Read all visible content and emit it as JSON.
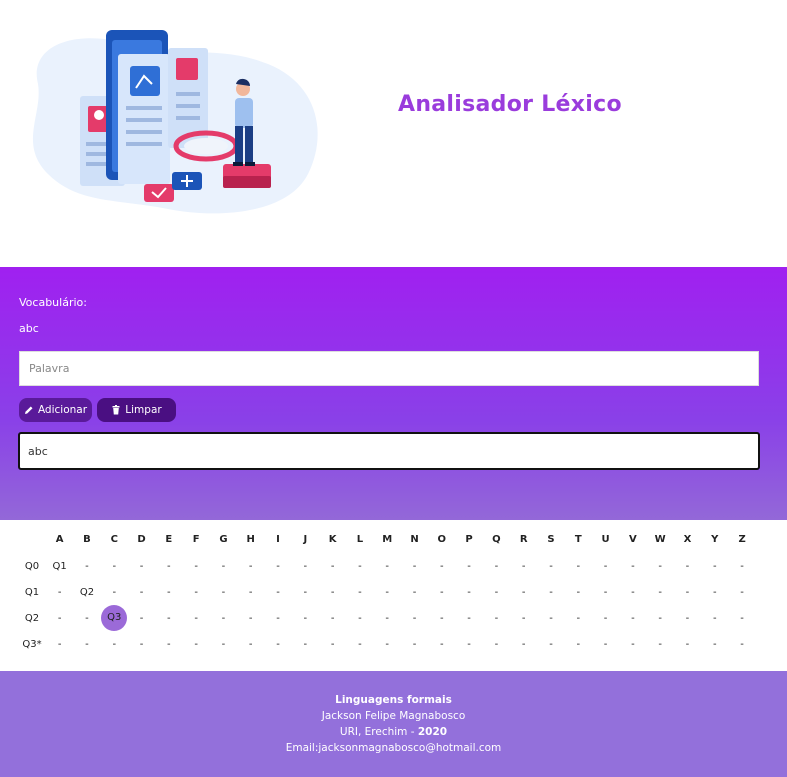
{
  "header": {
    "title": "Analisador Léxico"
  },
  "vocabulary": {
    "label": "Vocabulário:",
    "words": "abc",
    "word_input_placeholder": "Palavra",
    "add_button_label": "Adicionar",
    "clear_button_label": "Limpar",
    "test_input_value": "abc"
  },
  "table": {
    "columns": [
      "A",
      "B",
      "C",
      "D",
      "E",
      "F",
      "G",
      "H",
      "I",
      "J",
      "K",
      "L",
      "M",
      "N",
      "O",
      "P",
      "Q",
      "R",
      "S",
      "T",
      "U",
      "V",
      "W",
      "X",
      "Y",
      "Z"
    ],
    "rows": [
      {
        "state": "Q0",
        "cells": [
          "Q1",
          "-",
          "-",
          "-",
          "-",
          "-",
          "-",
          "-",
          "-",
          "-",
          "-",
          "-",
          "-",
          "-",
          "-",
          "-",
          "-",
          "-",
          "-",
          "-",
          "-",
          "-",
          "-",
          "-",
          "-",
          "-"
        ]
      },
      {
        "state": "Q1",
        "cells": [
          "-",
          "Q2",
          "-",
          "-",
          "-",
          "-",
          "-",
          "-",
          "-",
          "-",
          "-",
          "-",
          "-",
          "-",
          "-",
          "-",
          "-",
          "-",
          "-",
          "-",
          "-",
          "-",
          "-",
          "-",
          "-",
          "-"
        ]
      },
      {
        "state": "Q2",
        "cells": [
          "-",
          "-",
          "Q3",
          "-",
          "-",
          "-",
          "-",
          "-",
          "-",
          "-",
          "-",
          "-",
          "-",
          "-",
          "-",
          "-",
          "-",
          "-",
          "-",
          "-",
          "-",
          "-",
          "-",
          "-",
          "-",
          "-"
        ],
        "active_col": 2
      },
      {
        "state": "Q3*",
        "cells": [
          "-",
          "-",
          "-",
          "-",
          "-",
          "-",
          "-",
          "-",
          "-",
          "-",
          "-",
          "-",
          "-",
          "-",
          "-",
          "-",
          "-",
          "-",
          "-",
          "-",
          "-",
          "-",
          "-",
          "-",
          "-",
          "-"
        ]
      }
    ]
  },
  "footer": {
    "course": "Linguagens formais",
    "author": "Jackson Felipe Magnabosco",
    "place": "URI, Erechim - ",
    "year": "2020",
    "email": "Email:jacksonmagnabosco@hotmail.com"
  },
  "colors": {
    "accent": "#9a3cdc",
    "vocab_gradient_top": "#a020f0",
    "vocab_gradient_bottom": "#9368d8",
    "footer_bg": "#9370db",
    "active_cell": "#9b6ad8"
  }
}
